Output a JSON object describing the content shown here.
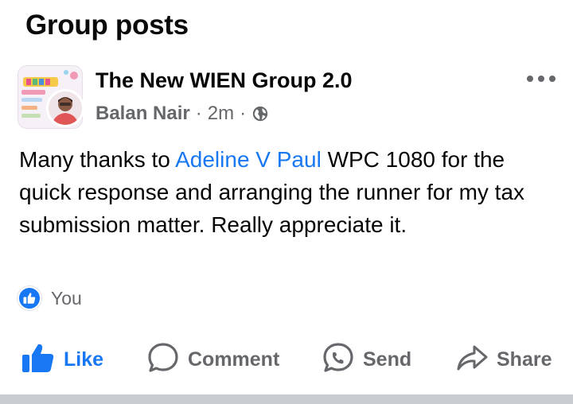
{
  "section": {
    "title": "Group posts"
  },
  "post": {
    "group_name": "The New WIEN Group 2.0",
    "author": "Balan Nair",
    "time": "2m",
    "separator": "·",
    "privacy_icon": "globe-icon",
    "more_icon": "more-dots-icon",
    "body": {
      "before": "Many thanks to ",
      "mention": "Adeline V Paul",
      "after": " WPC 1080 for the quick response and arranging the runner for my tax submission matter. Really appreciate it."
    },
    "reactions": {
      "icon": "like-reaction-icon",
      "who": "You"
    }
  },
  "actions": {
    "like": {
      "label": "Like",
      "icon": "thumbs-up-icon",
      "active": true
    },
    "comment": {
      "label": "Comment",
      "icon": "comment-bubble-icon"
    },
    "send": {
      "label": "Send",
      "icon": "messenger-icon"
    },
    "share": {
      "label": "Share",
      "icon": "share-arrow-icon"
    }
  },
  "colors": {
    "accent": "#1877f2",
    "secondary_text": "#65676b",
    "divider": "#c9ccd1"
  }
}
